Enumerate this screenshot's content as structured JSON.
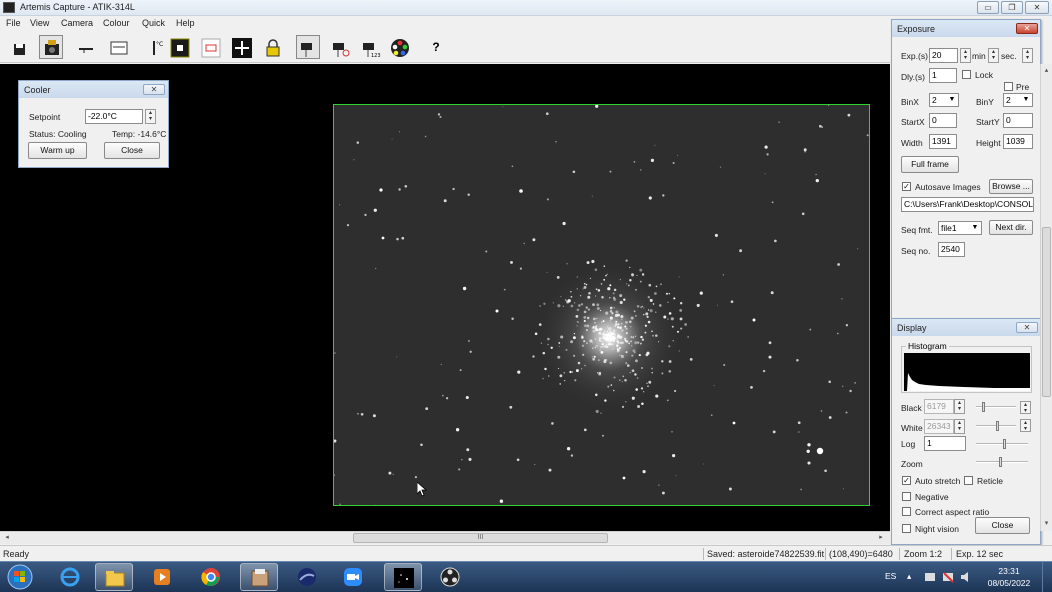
{
  "window": {
    "title": "Artemis Capture - ATIK-314L"
  },
  "menu": [
    "File",
    "View",
    "Camera",
    "Colour",
    "Quick",
    "Help"
  ],
  "toolbar": {
    "help_label": "?"
  },
  "cooler": {
    "title": "Cooler",
    "setpoint_label": "Setpoint",
    "setpoint_value": "-22.0°C",
    "status_label": "Status: Cooling",
    "temp_label": "Temp: -14.6°C",
    "warm_up_label": "Warm up",
    "close_label": "Close"
  },
  "exposure": {
    "title": "Exposure",
    "exp_label": "Exp.(s)",
    "exp_value": "20",
    "min_label": "min",
    "sec_label": "sec.",
    "dly_label": "Dly.(s)",
    "dly_value": "1",
    "lock_label": "Lock",
    "pre_label": "Pre",
    "binx_label": "BinX",
    "binx_value": "2",
    "biny_label": "BinY",
    "biny_value": "2",
    "startx_label": "StartX",
    "startx_value": "0",
    "starty_label": "StartY",
    "starty_value": "0",
    "width_label": "Width",
    "width_value": "1391",
    "height_label": "Height",
    "height_value": "1039",
    "full_frame_label": "Full frame",
    "autosave_label": "Autosave Images",
    "autosave_checked": true,
    "browse_label": "Browse ...",
    "path_value": "C:\\Users\\Frank\\Desktop\\CONSOL",
    "seq_fmt_label": "Seq fmt.",
    "seq_fmt_value": "file1",
    "next_dir_label": "Next dir.",
    "seq_no_label": "Seq no.",
    "seq_no_value": "2540"
  },
  "display": {
    "title": "Display",
    "histogram_label": "Histogram",
    "black_label": "Black",
    "black_value": "6179",
    "white_label": "White",
    "white_value": "26343",
    "log_label": "Log",
    "log_value": "1",
    "zoom_label": "Zoom",
    "auto_stretch_label": "Auto stretch",
    "auto_stretch_checked": true,
    "reticle_label": "Reticle",
    "negative_label": "Negative",
    "correct_aspect_label": "Correct aspect ratio",
    "night_vision_label": "Night vision",
    "close_label": "Close"
  },
  "statusbar": {
    "ready": "Ready",
    "saved": "Saved: asteroide74822539.fit",
    "coords": "(108,490)=6480",
    "zoom": "Zoom 1:2",
    "exp": "Exp. 12 sec"
  },
  "taskbar": {
    "language": "ES",
    "time": "23:31",
    "date": "08/05/2022"
  },
  "scrollbar": {
    "grip": "III"
  },
  "colors": {
    "image_border": "#2fd32f",
    "accent": "#c9432f"
  }
}
